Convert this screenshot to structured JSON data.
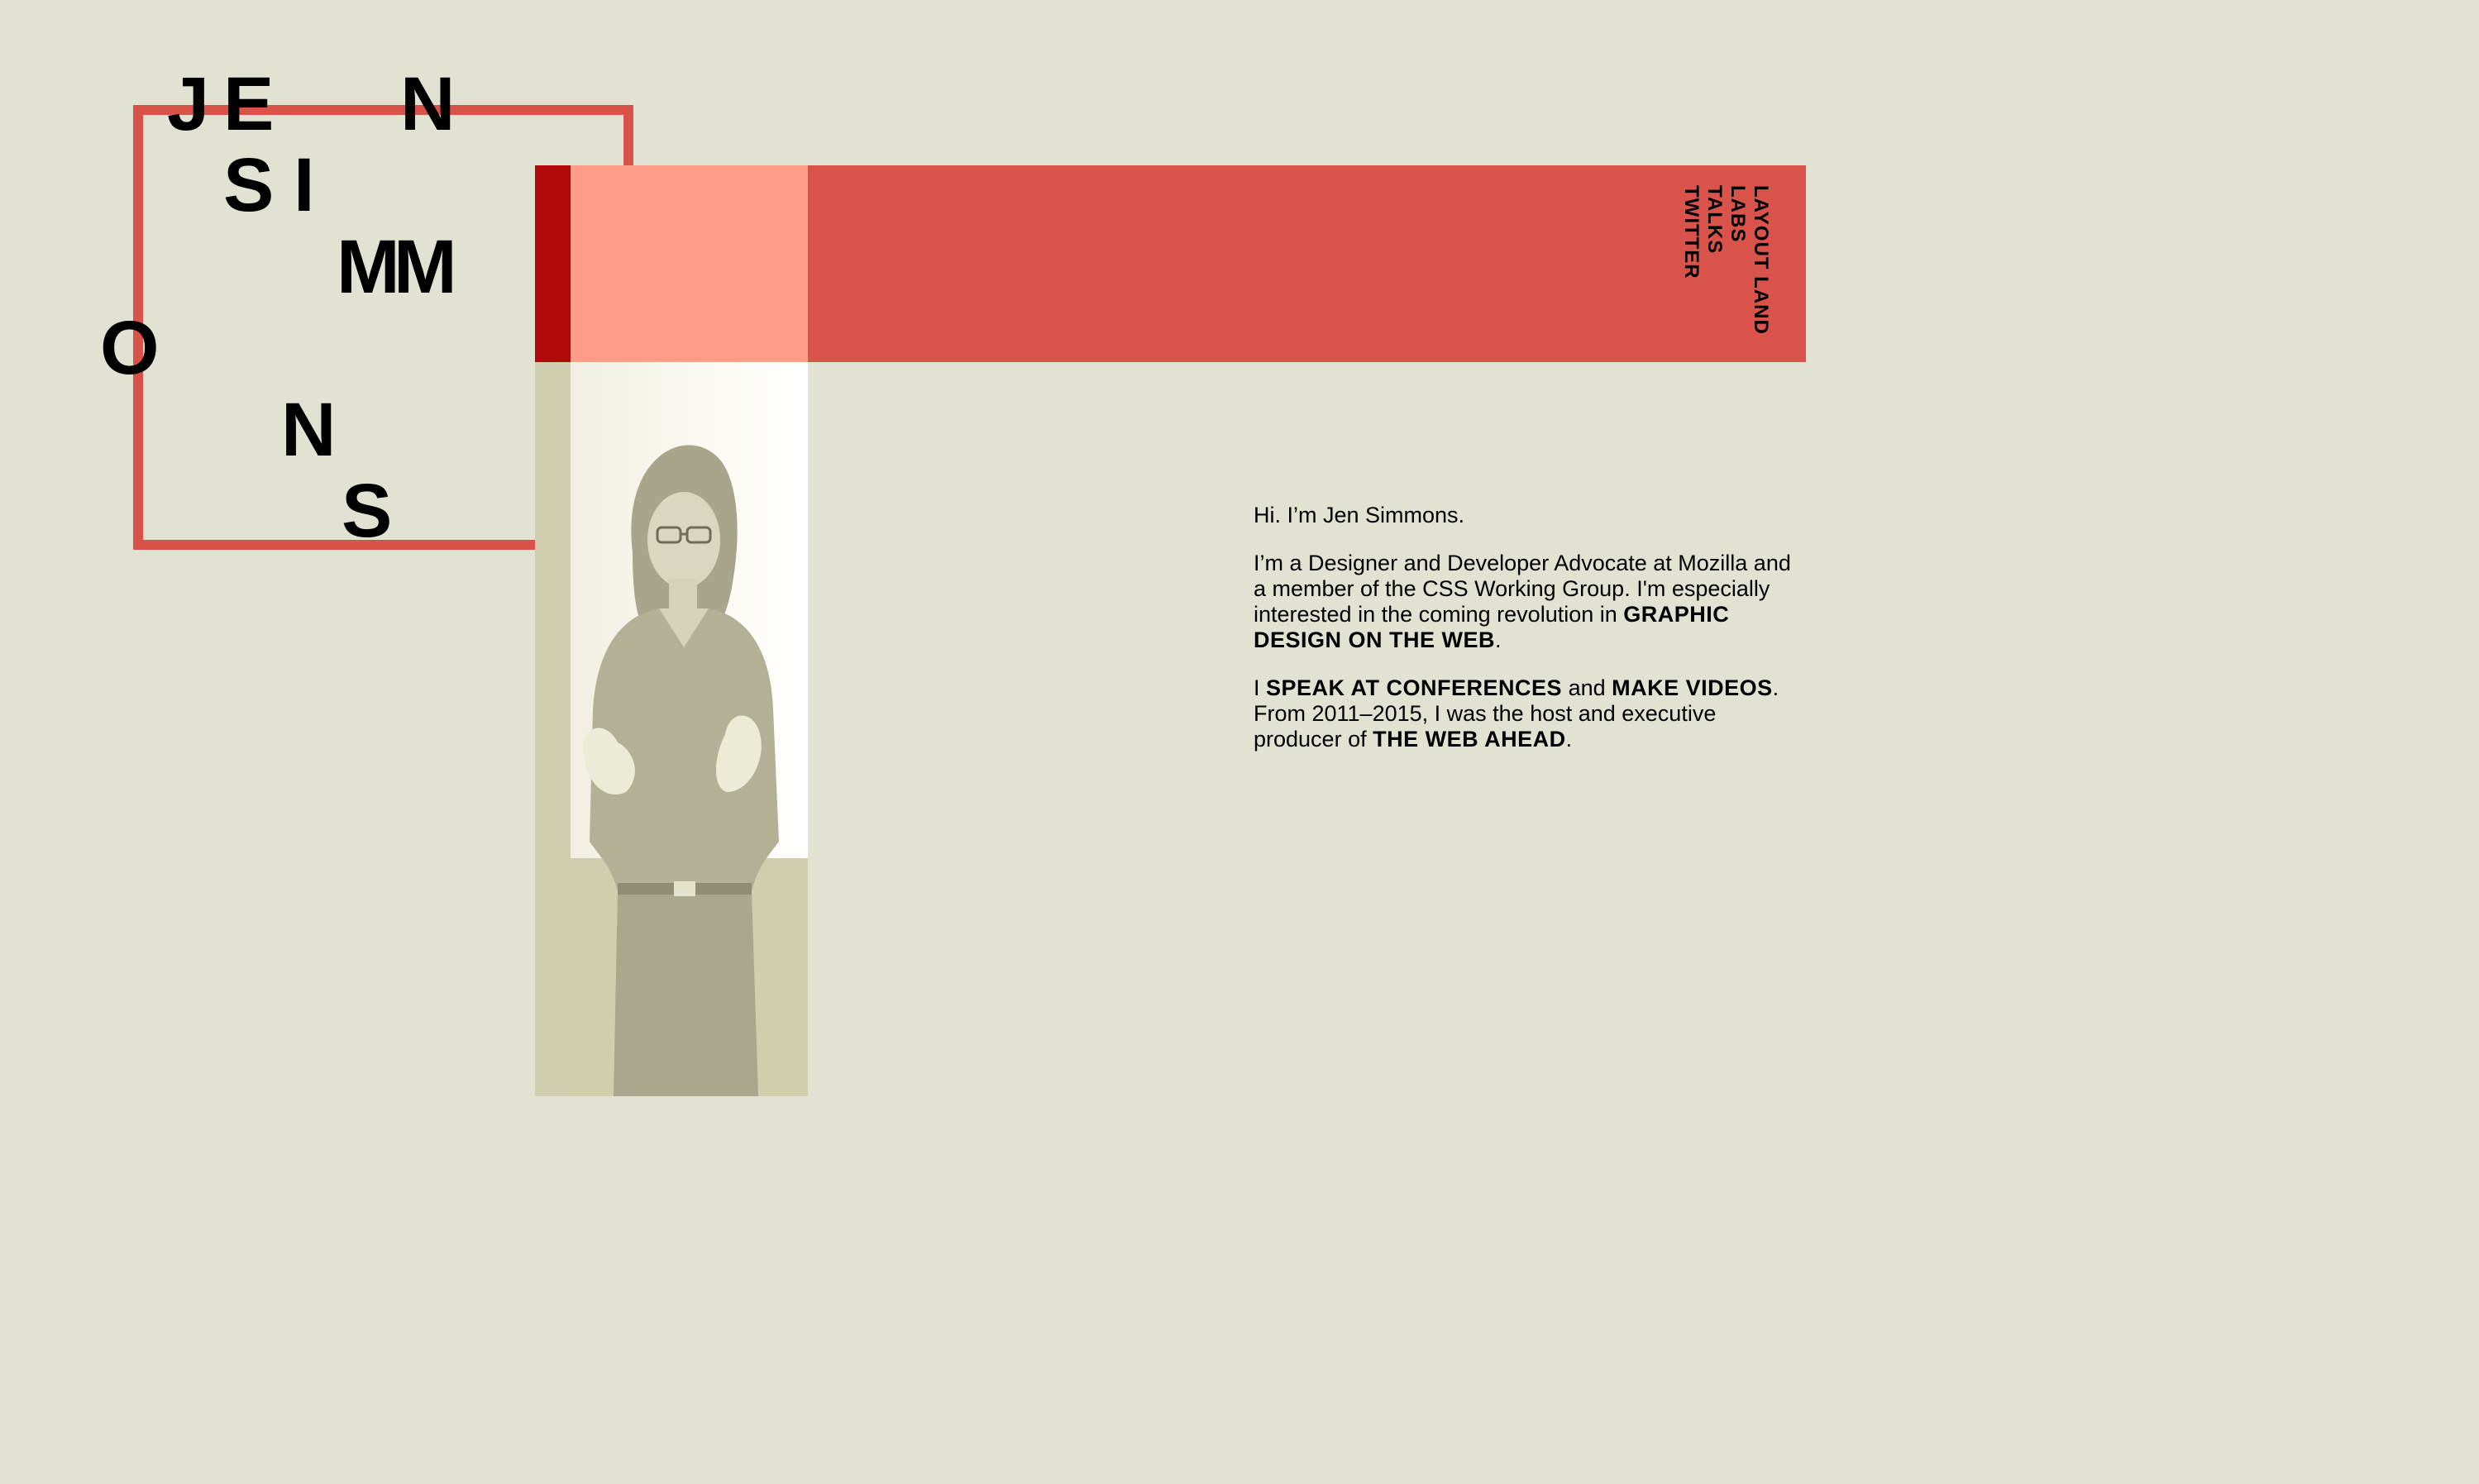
{
  "logo": {
    "letters": [
      "J",
      "E",
      "N",
      "S",
      "I",
      "M",
      "M",
      "O",
      "N",
      "S"
    ]
  },
  "nav": {
    "items": [
      {
        "label": "LAYOUT LAND"
      },
      {
        "label": "LABS"
      },
      {
        "label": "TALKS"
      },
      {
        "label": "TWITTER"
      }
    ]
  },
  "intro": {
    "greeting": "Hi. I’m Jen Simmons.",
    "p2_text1": "I’m a Designer and Developer Advocate at Mozilla and a member of the CSS Working Group. I'm especially interested in the coming revolution in ",
    "p2_link": "GRAPHIC DESIGN ON THE WEB",
    "p2_end": ".",
    "p3_start": "I ",
    "p3_link1": "SPEAK AT CONFERENCES",
    "p3_and": " and ",
    "p3_link2": "MAKE VIDEOS",
    "p3_text2": ". From 2011–2015, I was the host and executive producer of ",
    "p3_link3": "THE WEB AHEAD",
    "p3_end": "."
  },
  "colors": {
    "background": "#e2e2d3",
    "accent_red": "#d9534a",
    "dark_red": "#b30808",
    "light_salmon": "#ff9e86",
    "photo_tint": "#ccccaa"
  },
  "icons": {
    "photo": "portrait-photo"
  }
}
